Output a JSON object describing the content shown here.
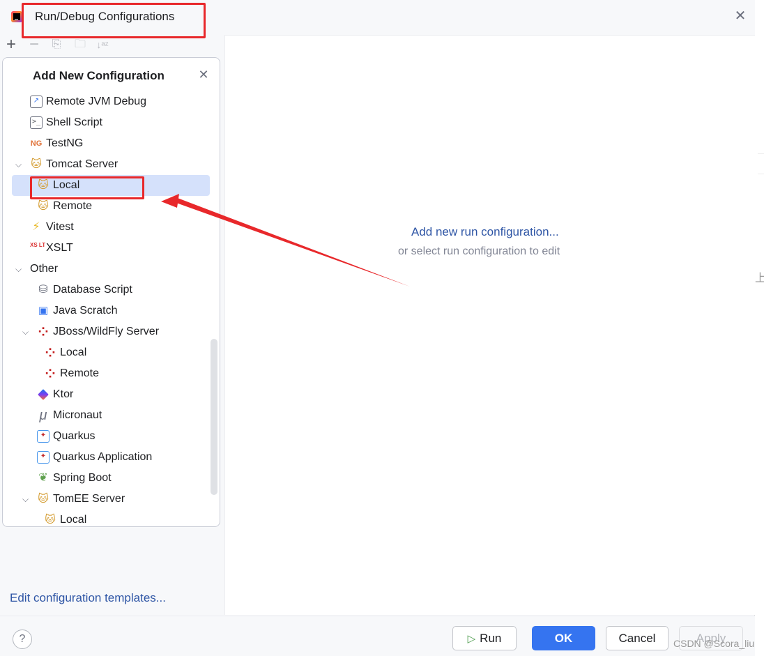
{
  "window": {
    "title": "Run/Debug Configurations",
    "close_icon": "close-icon"
  },
  "toolbar": {
    "add": "+",
    "remove": "−",
    "copy": "⎘",
    "folder": "🗀",
    "sort": "↓ᵃᶻ"
  },
  "popup": {
    "title": "Add New Configuration",
    "close_glyph": "✕",
    "items": [
      {
        "label": "Remote JVM Debug",
        "icon": "remote-jvm-debug-icon",
        "glyph": "↗"
      },
      {
        "label": "Shell Script",
        "icon": "shell-script-icon",
        "glyph": ">_"
      },
      {
        "label": "TestNG",
        "icon": "testng-icon",
        "glyph": "NG"
      },
      {
        "label": "Tomcat Server",
        "icon": "tomcat-icon",
        "glyph": "🐱",
        "expanded": true
      },
      {
        "label": "Local",
        "icon": "tomcat-icon",
        "glyph": "🐱",
        "selected": true
      },
      {
        "label": "Remote",
        "icon": "tomcat-icon",
        "glyph": "🐱"
      },
      {
        "label": "Vitest",
        "icon": "vitest-icon",
        "glyph": "⚡"
      },
      {
        "label": "XSLT",
        "icon": "xslt-icon",
        "glyph": "XS LT"
      },
      {
        "label": "Other",
        "expanded": true
      },
      {
        "label": "Database Script",
        "icon": "database-icon",
        "glyph": "⛁"
      },
      {
        "label": "Java Scratch",
        "icon": "java-scratch-icon",
        "glyph": "▣"
      },
      {
        "label": "JBoss/WildFly Server",
        "icon": "jboss-icon",
        "glyph": "⁘",
        "expanded": true
      },
      {
        "label": "Local",
        "icon": "jboss-icon",
        "glyph": "⁘"
      },
      {
        "label": "Remote",
        "icon": "jboss-icon",
        "glyph": "⁘"
      },
      {
        "label": "Ktor",
        "icon": "ktor-icon",
        "glyph": ""
      },
      {
        "label": "Micronaut",
        "icon": "micronaut-icon",
        "glyph": "μ"
      },
      {
        "label": "Quarkus",
        "icon": "quarkus-icon",
        "glyph": "✦"
      },
      {
        "label": "Quarkus Application",
        "icon": "quarkus-icon",
        "glyph": "✦"
      },
      {
        "label": "Spring Boot",
        "icon": "spring-boot-icon",
        "glyph": "❦"
      },
      {
        "label": "TomEE Server",
        "icon": "tomcat-icon",
        "glyph": "🐱",
        "expanded": true
      },
      {
        "label": "Local",
        "icon": "tomcat-icon",
        "glyph": "🐱"
      }
    ]
  },
  "center": {
    "link": "Add new run configuration...",
    "hint": "or select run configuration to edit"
  },
  "edit_templates": "Edit configuration templates...",
  "footer": {
    "help": "?",
    "run_label": "Run",
    "ok_label": "OK",
    "cancel_label": "Cancel",
    "apply_label": "Apply"
  },
  "watermark": "CSDN @Scora_liu",
  "colors": {
    "accent": "#3574f0",
    "link": "#2e55a5",
    "selection": "#d5e1fb",
    "annotation_red": "#e8282b"
  }
}
